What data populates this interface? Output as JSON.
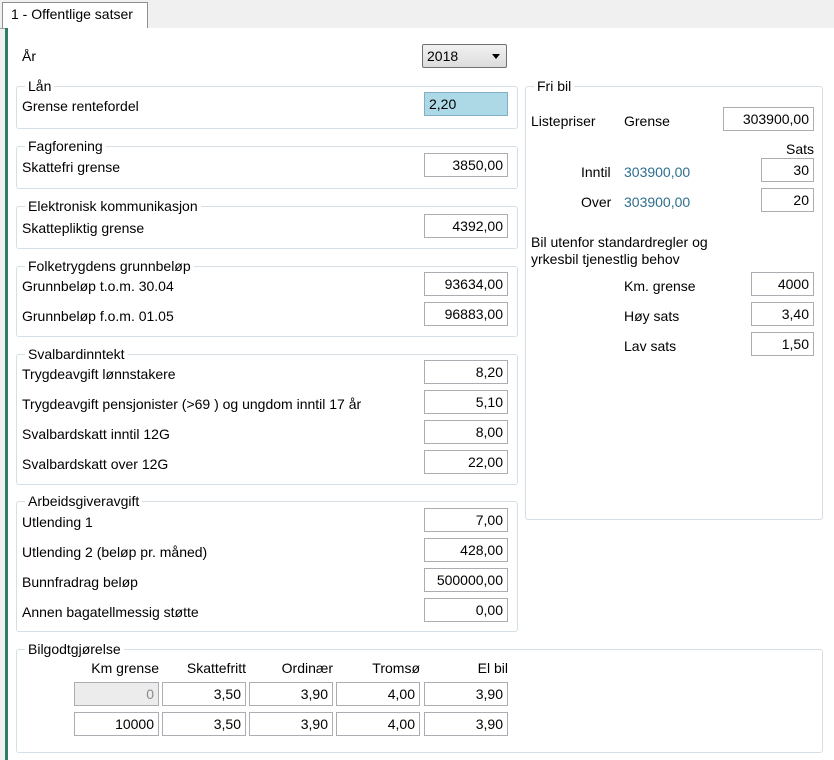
{
  "tab": {
    "label": "1 - Offentlige satser"
  },
  "year": {
    "label": "År",
    "value": "2018"
  },
  "lan": {
    "title": "Lån",
    "label": "Grense rentefordel",
    "value": "2,20"
  },
  "fagforening": {
    "title": "Fagforening",
    "label": "Skattefri grense",
    "value": "3850,00"
  },
  "elkom": {
    "title": "Elektronisk kommunikasjon",
    "label": "Skattepliktig grense",
    "value": "4392,00"
  },
  "grunnbelop": {
    "title": "Folketrygdens grunnbeløp",
    "rows": [
      {
        "label": "Grunnbeløp t.o.m. 30.04",
        "value": "93634,00"
      },
      {
        "label": "Grunnbeløp f.o.m. 01.05",
        "value": "96883,00"
      }
    ]
  },
  "svalbard": {
    "title": "Svalbardinntekt",
    "rows": [
      {
        "label": "Trygdeavgift lønnstakere",
        "value": "8,20"
      },
      {
        "label": "Trygdeavgift pensjonister (>69 ) og ungdom inntil 17 år",
        "value": "5,10"
      },
      {
        "label": "Svalbardskatt inntil 12G",
        "value": "8,00"
      },
      {
        "label": "Svalbardskatt over 12G",
        "value": "22,00"
      }
    ]
  },
  "arbeidsgiver": {
    "title": "Arbeidsgiveravgift",
    "rows": [
      {
        "label": "Utlending 1",
        "value": "7,00"
      },
      {
        "label": "Utlending 2 (beløp pr. måned)",
        "value": "428,00"
      },
      {
        "label": "Bunnfradrag beløp",
        "value": "500000,00"
      },
      {
        "label": "Annen bagatellmessig støtte",
        "value": "0,00"
      }
    ]
  },
  "fribil": {
    "title": "Fri bil",
    "listepriser": "Listepriser",
    "grense_label": "Grense",
    "grense_value": "303900,00",
    "sats_header": "Sats",
    "inntil_label": "Inntil",
    "inntil_amount": "303900,00",
    "inntil_sats": "30",
    "over_label": "Over",
    "over_amount": "303900,00",
    "over_sats": "20",
    "utenfor_text_1": "Bil utenfor standardregler og",
    "utenfor_text_2": "yrkesbil tjenestlig behov",
    "km_label": "Km. grense",
    "km_value": "4000",
    "hoy_label": "Høy sats",
    "hoy_value": "3,40",
    "lav_label": "Lav sats",
    "lav_value": "1,50"
  },
  "bilgodt": {
    "title": "Bilgodtgjørelse",
    "headers": [
      "Km grense",
      "Skattefritt",
      "Ordinær",
      "Tromsø",
      "El bil"
    ],
    "rows": [
      [
        "0",
        "3,50",
        "3,90",
        "4,00",
        "3,90"
      ],
      [
        "10000",
        "3,50",
        "3,90",
        "4,00",
        "3,90"
      ]
    ]
  }
}
